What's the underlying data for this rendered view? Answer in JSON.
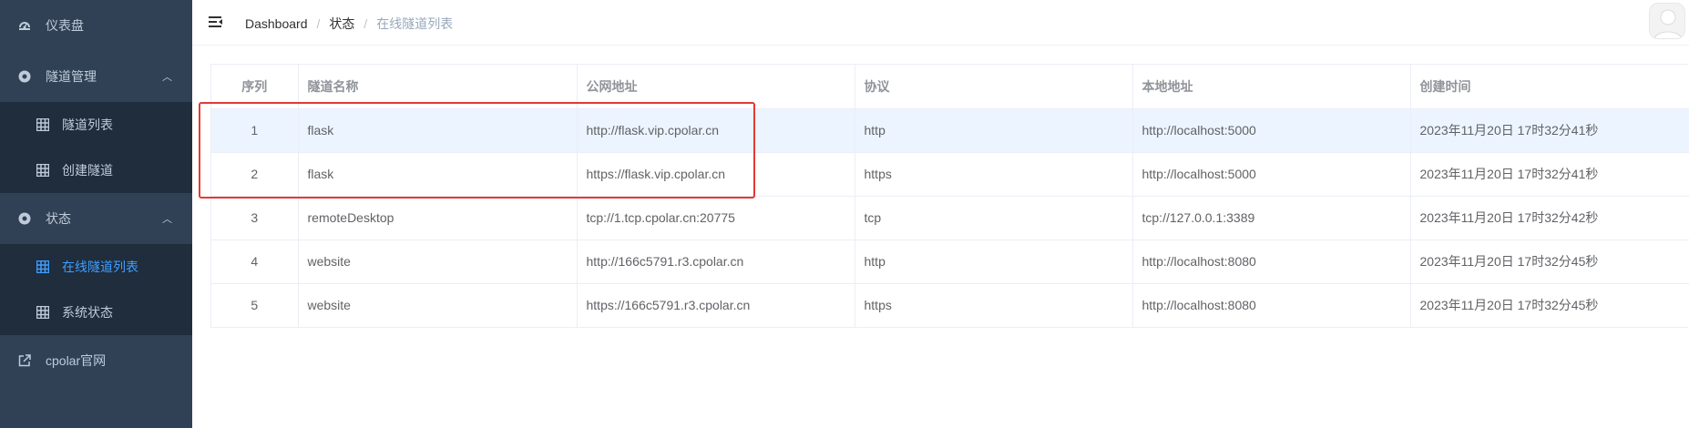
{
  "sidebar": {
    "items": [
      {
        "label": "仪表盘",
        "icon": "dashboard-icon"
      },
      {
        "label": "隧道管理",
        "icon": "settings-circle-icon",
        "expanded": true,
        "children": [
          {
            "label": "隧道列表",
            "icon": "grid-icon"
          },
          {
            "label": "创建隧道",
            "icon": "grid-icon"
          }
        ]
      },
      {
        "label": "状态",
        "icon": "settings-circle-icon",
        "expanded": true,
        "children": [
          {
            "label": "在线隧道列表",
            "icon": "grid-icon",
            "active": true
          },
          {
            "label": "系统状态",
            "icon": "grid-icon"
          }
        ]
      },
      {
        "label": "cpolar官网",
        "icon": "external-link-icon"
      }
    ]
  },
  "breadcrumb": [
    "Dashboard",
    "状态",
    "在线隧道列表"
  ],
  "table": {
    "headers": [
      "序列",
      "隧道名称",
      "公网地址",
      "协议",
      "本地地址",
      "创建时间"
    ],
    "rows": [
      [
        "1",
        "flask",
        "http://flask.vip.cpolar.cn",
        "http",
        "http://localhost:5000",
        "2023年11月20日 17时32分41秒"
      ],
      [
        "2",
        "flask",
        "https://flask.vip.cpolar.cn",
        "https",
        "http://localhost:5000",
        "2023年11月20日 17时32分41秒"
      ],
      [
        "3",
        "remoteDesktop",
        "tcp://1.tcp.cpolar.cn:20775",
        "tcp",
        "tcp://127.0.0.1:3389",
        "2023年11月20日 17时32分42秒"
      ],
      [
        "4",
        "website",
        "http://166c5791.r3.cpolar.cn",
        "http",
        "http://localhost:8080",
        "2023年11月20日 17时32分45秒"
      ],
      [
        "5",
        "website",
        "https://166c5791.r3.cpolar.cn",
        "https",
        "http://localhost:8080",
        "2023年11月20日 17时32分45秒"
      ]
    ]
  },
  "colors": {
    "sidebar_bg": "#304156",
    "submenu_bg": "#1f2d3d",
    "accent": "#409eff",
    "highlight_row": "#ecf5ff",
    "annotation": "#e53935"
  }
}
